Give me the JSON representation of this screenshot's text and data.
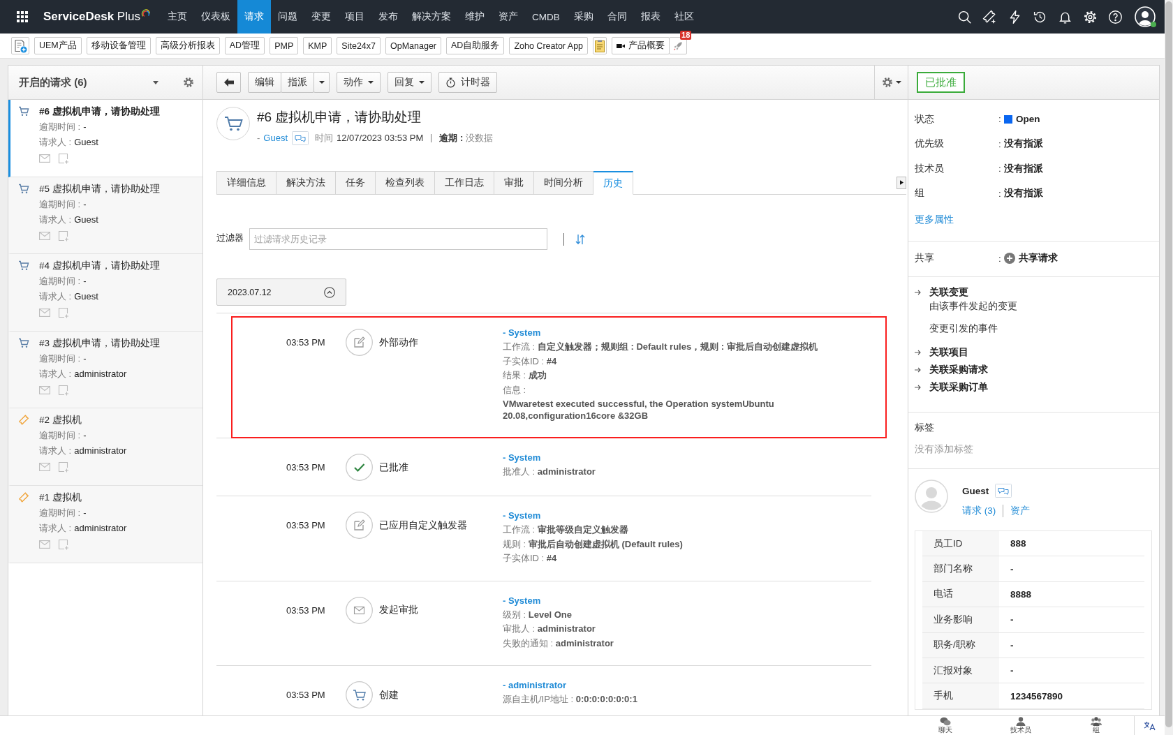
{
  "topnav": {
    "product": "**ServiceDesk** Plus",
    "menu": [
      {
        "label": "主页",
        "selected": false
      },
      {
        "label": "仪表板",
        "selected": false
      },
      {
        "label": "请求",
        "selected": true
      },
      {
        "label": "问题",
        "selected": false
      },
      {
        "label": "变更",
        "selected": false
      },
      {
        "label": "项目",
        "selected": false
      },
      {
        "label": "发布",
        "selected": false
      },
      {
        "label": "解决方案",
        "selected": false
      },
      {
        "label": "维护",
        "selected": false
      },
      {
        "label": "资产",
        "selected": false
      },
      {
        "label": "CMDB",
        "selected": false
      },
      {
        "label": "采购",
        "selected": false
      },
      {
        "label": "合同",
        "selected": false
      },
      {
        "label": "报表",
        "selected": false
      },
      {
        "label": "社区",
        "selected": false
      }
    ],
    "user": {
      "online": true
    }
  },
  "bookmarks": [
    {
      "kind": "new"
    },
    {
      "kind": "link",
      "label": "UEM产品"
    },
    {
      "kind": "link",
      "label": "移动设备管理"
    },
    {
      "kind": "link",
      "label": "高级分析报表"
    },
    {
      "kind": "link",
      "label": "AD管理"
    },
    {
      "kind": "link",
      "label": "PMP"
    },
    {
      "kind": "link",
      "label": "KMP"
    },
    {
      "kind": "link",
      "label": "Site24x7"
    },
    {
      "kind": "link",
      "label": "OpManager"
    },
    {
      "kind": "link",
      "label": "AD自助服务"
    },
    {
      "kind": "link",
      "label": "Zoho Creator App"
    },
    {
      "kind": "note"
    },
    {
      "kind": "video",
      "label": "产品概要"
    },
    {
      "kind": "rocket",
      "badge": "18"
    }
  ],
  "request_list": {
    "title": "开启的请求 (6)",
    "items": [
      {
        "kind": "service",
        "title": "#6 虚拟机申请，请协助处理",
        "due_label": "逾期时间 :",
        "due": "-",
        "requester_label": "请求人 :",
        "requester": "Guest",
        "selected": true
      },
      {
        "kind": "service",
        "title": "#5 虚拟机申请，请协助处理",
        "due_label": "逾期时间 :",
        "due": "-",
        "requester_label": "请求人 :",
        "requester": "Guest",
        "selected": false
      },
      {
        "kind": "service",
        "title": "#4 虚拟机申请，请协助处理",
        "due_label": "逾期时间 :",
        "due": "-",
        "requester_label": "请求人 :",
        "requester": "Guest",
        "selected": false
      },
      {
        "kind": "service",
        "title": "#3 虚拟机申请，请协助处理",
        "due_label": "逾期时间 :",
        "due": "-",
        "requester_label": "请求人 :",
        "requester": "administrator",
        "selected": false
      },
      {
        "kind": "incident",
        "title": "#2 虚拟机",
        "due_label": "逾期时间 :",
        "due": "-",
        "requester_label": "请求人 :",
        "requester": "administrator",
        "selected": false
      },
      {
        "kind": "incident",
        "title": "#1 虚拟机",
        "due_label": "逾期时间 :",
        "due": "-",
        "requester_label": "请求人 :",
        "requester": "administrator",
        "selected": false
      }
    ]
  },
  "toolbar": [
    {
      "buttons": [
        {
          "kind": "back"
        }
      ]
    },
    {
      "buttons": [
        {
          "kind": "plain",
          "label": "编辑"
        },
        {
          "kind": "plain",
          "label": "指派"
        },
        {
          "kind": "caret"
        }
      ]
    },
    {
      "buttons": [
        {
          "kind": "menu",
          "label": "动作"
        }
      ]
    },
    {
      "buttons": [
        {
          "kind": "menu",
          "label": "回复"
        }
      ]
    },
    {
      "buttons": [
        {
          "kind": "timer",
          "label": "计时器"
        }
      ]
    }
  ],
  "request": {
    "title": "#6 虚拟机申请，请协助处理",
    "requester_prefix": "-",
    "requester": "Guest",
    "time_label": "时间",
    "time": "12/07/2023 03:53 PM",
    "due_label": "逾期 :",
    "due": "没数据"
  },
  "tabs": [
    {
      "label": "详细信息",
      "selected": false
    },
    {
      "label": "解决方法",
      "selected": false
    },
    {
      "label": "任务",
      "selected": false
    },
    {
      "label": "检查列表",
      "selected": false
    },
    {
      "label": "工作日志",
      "selected": false
    },
    {
      "label": "审批",
      "selected": false
    },
    {
      "label": "时间分析",
      "selected": false
    },
    {
      "label": "历史",
      "selected": true
    }
  ],
  "filter": {
    "label": "过滤器",
    "placeholder": "过滤请求历史记录"
  },
  "history": {
    "date": "2023.07.12",
    "expanded": true,
    "entries": [
      {
        "kind": "action",
        "time": "03:53 PM",
        "action": "外部动作",
        "actor": "- System",
        "highlighted": true,
        "details": [
          "工作流 : **自定义触发器；规则组 : Default rules，规则 : 审批后自动创建虚拟机**",
          "子实体ID : **#4**",
          "结果 : **成功**",
          "信息 :",
          "**VMwaretest executed successful, the Operation systemUbuntu 20.08,configuration16core &32GB**"
        ]
      },
      {
        "kind": "approved",
        "time": "03:53 PM",
        "action": "已批准",
        "actor": "- System",
        "highlighted": false,
        "details": [
          "批准人 : **administrator**"
        ]
      },
      {
        "kind": "trigger",
        "time": "03:53 PM",
        "action": "已应用自定义触发器",
        "actor": "- System",
        "highlighted": false,
        "details": [
          "工作流 : **审批等级自定义触发器**",
          "规则 : **审批后自动创建虚拟机 (Default rules)**",
          "子实体ID : **#4**"
        ]
      },
      {
        "kind": "approval_request",
        "time": "03:53 PM",
        "action": "发起审批",
        "actor": "- System",
        "highlighted": false,
        "details": [
          "级别 : **Level One**",
          "审批人 : **administrator**",
          "失败的通知 : **administrator**"
        ]
      },
      {
        "kind": "create",
        "time": "03:53 PM",
        "action": "创建",
        "actor": "- administrator",
        "highlighted": false,
        "details": [
          "源自主机/IP地址 : **0:0:0:0:0:0:0:1**"
        ]
      }
    ]
  },
  "status_badge": "已批准",
  "properties": [
    {
      "kind": "status",
      "label": "状态",
      "colon": ":",
      "value": "Open",
      "color": "#0a66f0"
    },
    {
      "kind": "text",
      "label": "优先级",
      "colon": ":",
      "value": "没有指派"
    },
    {
      "kind": "text",
      "label": "技术员",
      "colon": ":",
      "value": "没有指派"
    },
    {
      "kind": "text",
      "label": "组",
      "colon": ":",
      "value": "没有指派"
    }
  ],
  "more_link": "更多属性",
  "share": {
    "label": "共享",
    "colon": ":",
    "action": "共享请求"
  },
  "related": [
    {
      "label": "关联变更",
      "children": [
        {
          "label": "由该事件发起的变更"
        },
        {
          "label": "变更引发的事件"
        }
      ]
    },
    {
      "label": "关联项目"
    },
    {
      "label": "关联采购请求"
    },
    {
      "label": "关联采购订单"
    }
  ],
  "tags": {
    "title": "标签",
    "empty": "没有添加标签"
  },
  "requester": {
    "name": "Guest",
    "links": [
      "请求 (3)",
      "资产"
    ],
    "fields": [
      {
        "label": "员工ID",
        "value": "888"
      },
      {
        "label": "部门名称",
        "value": "-"
      },
      {
        "label": "电话",
        "value": "8888"
      },
      {
        "label": "业务影响",
        "value": "-"
      },
      {
        "label": "职务/职称",
        "value": "-"
      },
      {
        "label": "汇报对象",
        "value": "-"
      },
      {
        "label": "手机",
        "value": "1234567890"
      }
    ]
  },
  "bottom_bar": [
    {
      "kind": "chat",
      "label": "聊天"
    },
    {
      "kind": "technician",
      "label": "技术员"
    },
    {
      "kind": "group",
      "label": "组"
    }
  ]
}
